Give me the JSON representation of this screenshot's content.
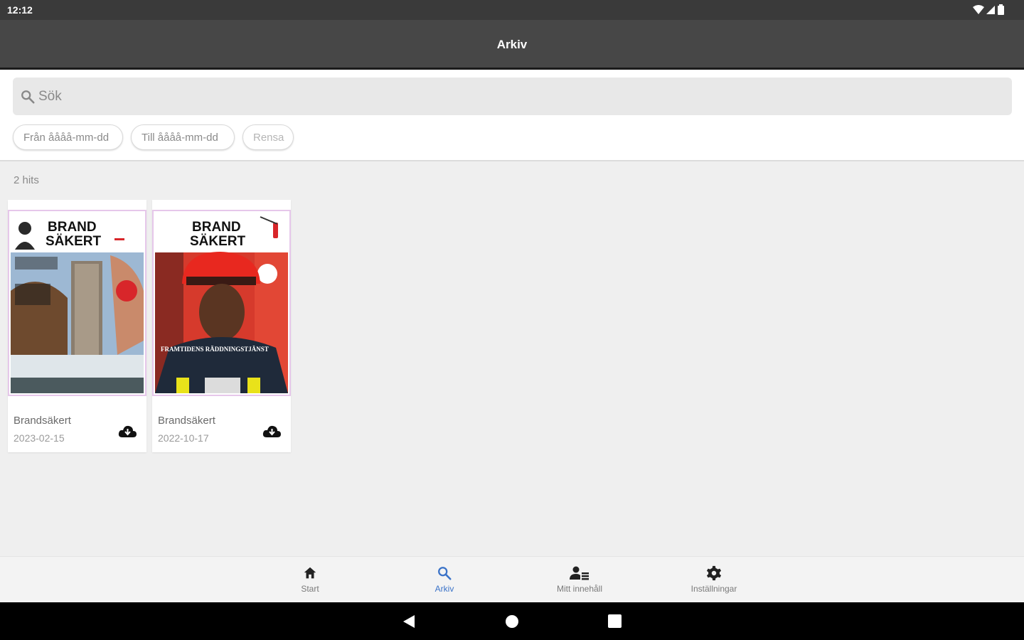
{
  "status_bar": {
    "time": "12:12",
    "icons": [
      "wifi-icon",
      "signal-icon",
      "battery-icon"
    ]
  },
  "app_bar": {
    "title": "Arkiv"
  },
  "search": {
    "placeholder": "Sök",
    "icon": "search-icon"
  },
  "filters": {
    "from_placeholder": "Från åååå-mm-dd",
    "to_placeholder": "Till åååå-mm-dd",
    "clear_label": "Rensa"
  },
  "results": {
    "count_label": "2 hits",
    "items": [
      {
        "title": "Brandsäkert",
        "date": "2023-02-15",
        "cover_masthead": [
          "BRAND",
          "SÄKERT"
        ],
        "action_icon": "cloud-download-icon"
      },
      {
        "title": "Brandsäkert",
        "date": "2022-10-17",
        "cover_masthead": [
          "BRAND",
          "SÄKERT"
        ],
        "cover_headline": "FRAMTIDENS RÄDDNINGSTJÄNST",
        "action_icon": "cloud-download-icon"
      }
    ]
  },
  "bottom_nav": {
    "items": [
      {
        "label": "Start",
        "icon": "home-icon"
      },
      {
        "label": "Arkiv",
        "icon": "search-icon",
        "active": true
      },
      {
        "label": "Mitt innehåll",
        "icon": "person-list-icon"
      },
      {
        "label": "Inställningar",
        "icon": "gear-icon"
      }
    ]
  },
  "colors": {
    "app_bar": "#474747",
    "status_bar": "#3a3a3a",
    "active_nav": "#3b73c8",
    "background": "#efefef"
  }
}
